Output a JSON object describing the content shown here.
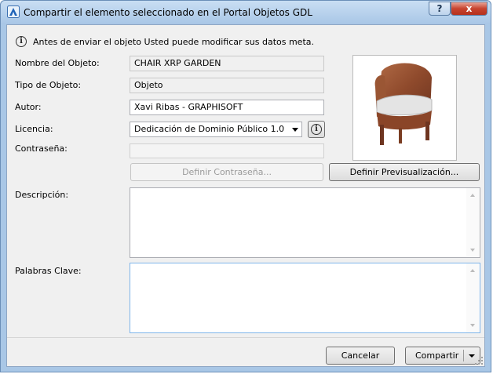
{
  "window": {
    "title": "Compartir el elemento seleccionado en el Portal Objetos GDL",
    "help_label": "?",
    "close_label": "x"
  },
  "info_message": "Antes de enviar el objeto Usted puede modificar sus datos meta.",
  "form": {
    "name_label": "Nombre del Objeto:",
    "name_value": "CHAIR XRP GARDEN",
    "type_label": "Tipo de Objeto:",
    "type_value": "Objeto",
    "author_label": "Autor:",
    "author_value": "Xavi Ribas - GRAPHISOFT",
    "license_label": "Licencia:",
    "license_value": "Dedicación de Dominio Público 1.0",
    "password_label": "Contraseña:",
    "password_value": "",
    "define_password_label": "Definir Contraseña...",
    "define_preview_label": "Definir Previsualización...",
    "description_label": "Descripción:",
    "description_value": "",
    "keywords_label": "Palabras Clave:",
    "keywords_value": ""
  },
  "footer": {
    "cancel_label": "Cancelar",
    "share_label": "Compartir"
  },
  "icons": {
    "app": "archicad-app-icon",
    "info": "info-icon",
    "license_info": "info-icon",
    "preview": "chair-preview-image"
  },
  "colors": {
    "titlebar": "#b9d3ee",
    "dialog_bg": "#f0f0f0",
    "close_button": "#c7432f"
  }
}
